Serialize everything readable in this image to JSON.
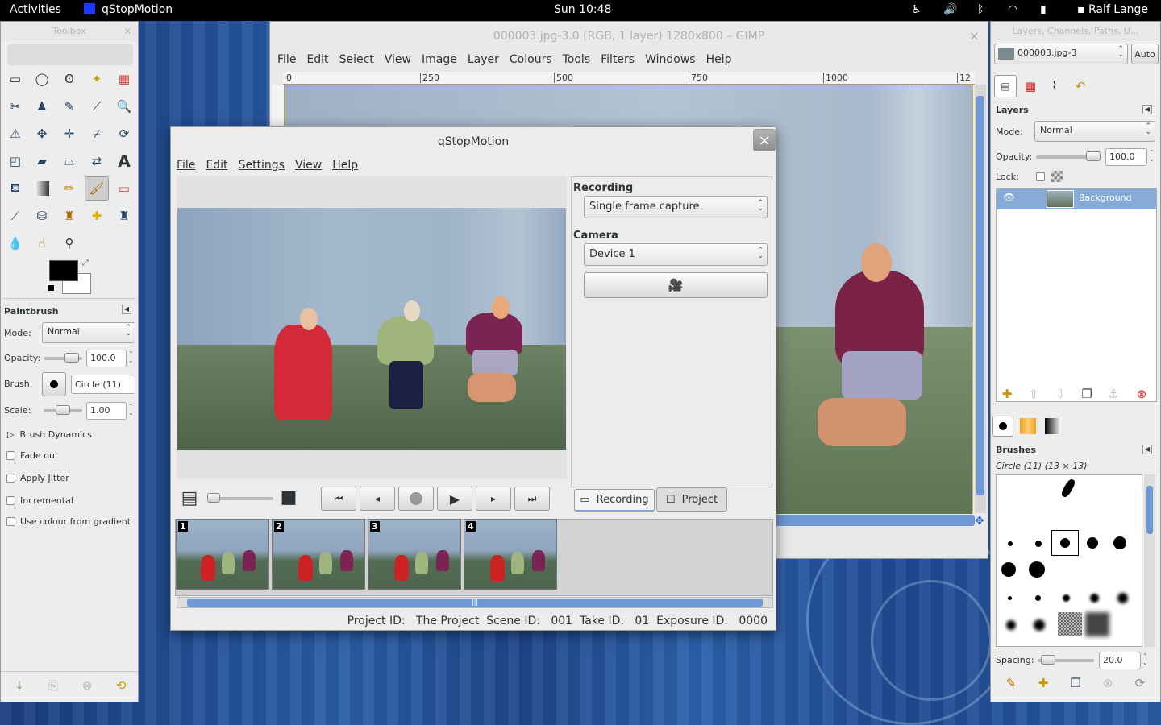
{
  "topbar": {
    "activities": "Activities",
    "app": "qStopMotion",
    "clock": "Sun 10:48",
    "user": "Ralf Lange",
    "icons": [
      "accessibility-icon",
      "volume-icon",
      "bluetooth-icon",
      "wifi-icon",
      "battery-icon",
      "chat-icon"
    ]
  },
  "toolbox": {
    "title": "Toolbox",
    "close": "×",
    "tool_options_title": "Paintbrush",
    "mode_label": "Mode:",
    "mode_value": "Normal",
    "opacity_label": "Opacity:",
    "opacity_value": "100.0",
    "brush_label": "Brush:",
    "brush_value": "Circle (11)",
    "scale_label": "Scale:",
    "scale_value": "1.00",
    "dynamics": "Brush Dynamics",
    "options": [
      "Fade out",
      "Apply Jitter",
      "Incremental",
      "Use colour from gradient"
    ],
    "fg_color": "#000000",
    "bg_color": "#ffffff"
  },
  "gimp": {
    "title": "000003.jpg-3.0 (RGB, 1 layer) 1280x800 – GIMP",
    "close": "×",
    "menu": [
      "File",
      "Edit",
      "Select",
      "View",
      "Image",
      "Layer",
      "Colours",
      "Tools",
      "Filters",
      "Windows",
      "Help"
    ],
    "ruler": [
      "0",
      "250",
      "500",
      "750",
      "1000",
      "12"
    ]
  },
  "qstop": {
    "title": "qStopMotion",
    "close": "×",
    "menu": [
      "File",
      "Edit",
      "Settings",
      "View",
      "Help"
    ],
    "recording_label": "Recording",
    "recording_value": "Single frame capture",
    "camera_label": "Camera",
    "camera_value": "Device 1",
    "tabs": [
      "Recording",
      "Project"
    ],
    "frames": [
      "1",
      "2",
      "3",
      "4"
    ],
    "status": "Project ID:   The Project  Scene ID:   001  Take ID:   01  Exposure ID:   0000"
  },
  "layers": {
    "title": "Layers, Channels, Paths, U...",
    "image": "000003.jpg-3",
    "auto": "Auto",
    "section": "Layers",
    "mode_label": "Mode:",
    "mode_value": "Normal",
    "opacity_label": "Opacity:",
    "opacity_value": "100.0",
    "lock_label": "Lock:",
    "layer_name": "Background",
    "brushes_title": "Brushes",
    "brush_info": "Circle (11) (13 × 13)",
    "spacing_label": "Spacing:",
    "spacing_value": "20.0"
  }
}
